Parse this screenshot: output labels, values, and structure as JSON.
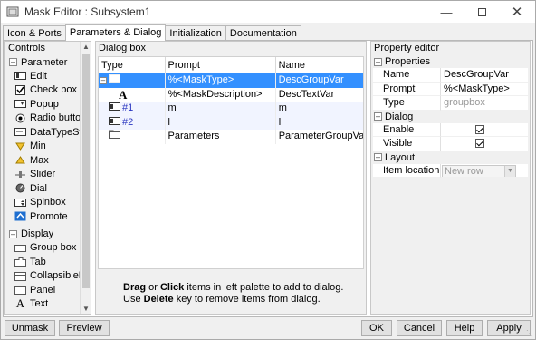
{
  "window": {
    "title": "Mask Editor : Subsystem1"
  },
  "tabs": [
    "Icon & Ports",
    "Parameters & Dialog",
    "Initialization",
    "Documentation"
  ],
  "controls": {
    "header": "Controls",
    "parameter_label": "Parameter",
    "parameter_items": [
      "Edit",
      "Check box",
      "Popup",
      "Radio butto",
      "DataTypeSt",
      "Min",
      "Max",
      "Slider",
      "Dial",
      "Spinbox",
      "Promote"
    ],
    "display_label": "Display",
    "display_items": [
      "Group box",
      "Tab",
      "CollapsibleP",
      "Panel",
      "Text"
    ]
  },
  "dialog": {
    "header": "Dialog box",
    "columns": [
      "Type",
      "Prompt",
      "Name"
    ],
    "rows": [
      {
        "type": "",
        "prompt": "%<MaskType>",
        "name": "DescGroupVar"
      },
      {
        "type": "A",
        "prompt": "%<MaskDescription>",
        "name": "DescTextVar"
      },
      {
        "type": "#1",
        "prompt": "m",
        "name": "m"
      },
      {
        "type": "#2",
        "prompt": "l",
        "name": "l"
      },
      {
        "type": "",
        "prompt": "Parameters",
        "name": "ParameterGroupVar"
      }
    ],
    "hint_bold1": "Drag",
    "hint_or": " or ",
    "hint_bold2": "Click",
    "hint_rest1": " items in left palette to add to dialog.",
    "hint_use": "Use ",
    "hint_bold3": "Delete",
    "hint_rest2": " key to remove items from dialog."
  },
  "property": {
    "header": "Property editor",
    "properties_label": "Properties",
    "name_key": "Name",
    "name_val": "DescGroupVar",
    "prompt_key": "Prompt",
    "prompt_val": "%<MaskType>",
    "type_key": "Type",
    "type_val": "groupbox",
    "dialog_label": "Dialog",
    "enable_key": "Enable",
    "enable_checked": true,
    "visible_key": "Visible",
    "visible_checked": true,
    "layout_label": "Layout",
    "item_location_key": "Item location",
    "item_location_val": "New row"
  },
  "buttons": {
    "unmask": "Unmask",
    "preview": "Preview",
    "ok": "OK",
    "cancel": "Cancel",
    "help": "Help",
    "apply": "Apply"
  },
  "colors": {
    "selection": "#3390ff",
    "accent_text": "#2a36c0"
  }
}
